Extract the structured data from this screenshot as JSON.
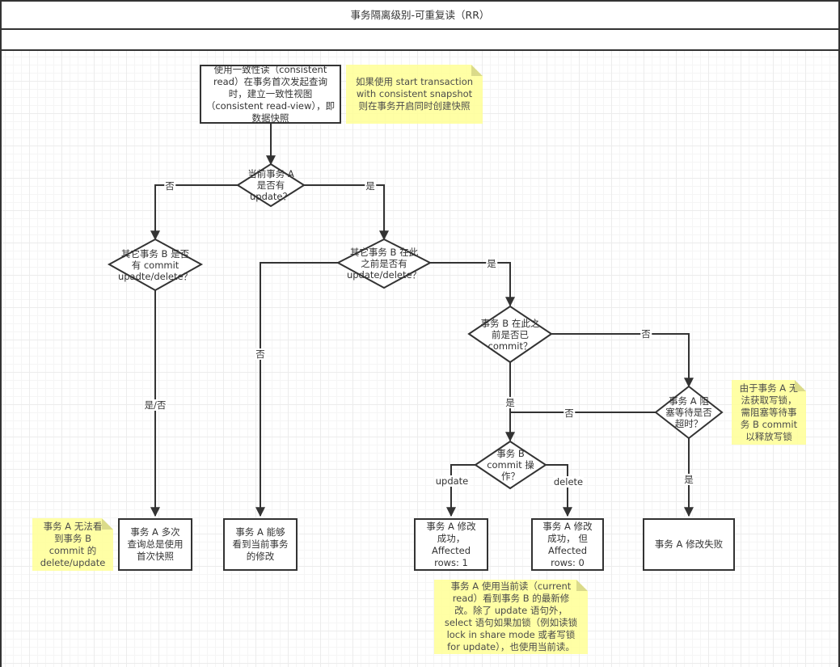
{
  "title": "事务隔离级别-可重复读（RR）",
  "nodes": {
    "start": "使用一致性读（consistent read）在事务首次发起查询时，建立一致性视图（consistent read-view），即数据快照",
    "d_a_update": "当前事务 A\n是否有\nupdate？",
    "d_b_commit": "其它事务 B 是否\n有  commit\nupadte/delete？",
    "d_b_before": "其它事务 B 在此\n之前是否有\nupdate/delete？",
    "d_b_committed": "事务 B 在此之\n前是否已\ncommit？",
    "d_timeout": "事务 A 阻\n塞等待是否\n超时？",
    "d_op": "事务 B\ncommit 操\n作？",
    "r_first_snapshot": "事务 A 多次\n查询总是使用\n首次快照",
    "r_see_own": "事务 A 能够\n看到当前事务\n的修改",
    "r_affected_1": "事务 A 修改\n成功，\nAffected\nrows: 1",
    "r_affected_0": "事务 A 修改\n成功， 但\nAffected\nrows: 0",
    "r_fail": "事务 A 修改失败"
  },
  "notes": {
    "snapshot": "如果使用 start transaction\nwith consistent snapshot\n则在事务开启同时创建快照",
    "blocked": "由于事务 A 无\n法获取写锁，\n需阻塞等待事\n务 B commit\n以释放写锁",
    "invisible": "事务 A 无法看\n到事务 B\ncommit 的\ndelete/update",
    "current_read": "事务 A 使用当前读（current\nread）看到事务 B 的最新修\n改。除了 update 语句外，\nselect 语句如果加锁（例如读锁\nlock in share mode 或者写锁\nfor update），也使用当前读。"
  },
  "edge_labels": {
    "a_no": "否",
    "a_yes": "是",
    "b_commit_yesno": "是/否",
    "b_before_no": "否",
    "b_before_yes": "是",
    "committed_no": "否",
    "committed_yes": "是",
    "timeout_no": "否",
    "timeout_yes": "是",
    "op_update": "update",
    "op_delete": "delete"
  },
  "colors": {
    "stroke": "#333333",
    "note_fill": "#ffff99",
    "grid": "#ececec"
  }
}
